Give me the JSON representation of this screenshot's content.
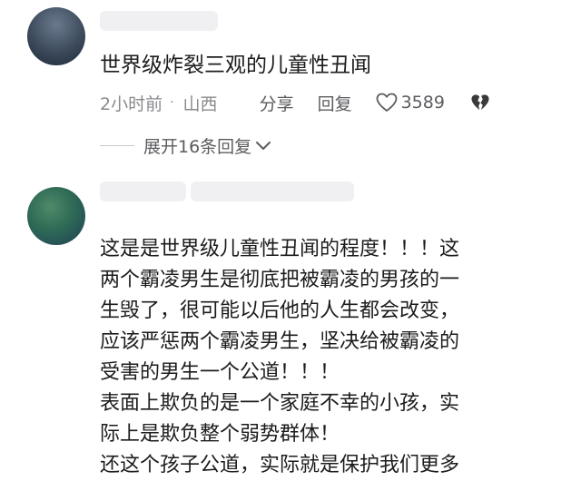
{
  "comment1": {
    "text": "世界级炸裂三观的儿童性丑闻",
    "time": "2小时前",
    "separator": "·",
    "location": "山西",
    "share_label": "分享",
    "reply_label": "回复",
    "like_count": "3589",
    "like_icon": "heart-outline-icon",
    "dislike_icon": "broken-heart-icon",
    "expand_label": "展开16条回复"
  },
  "comment2": {
    "lines": [
      "这是是世界级儿童性丑闻的程度！！！这",
      "两个霸凌男生是彻底把被霸凌的男孩的一",
      "生毁了，很可能以后他的人生都会改变，",
      "应该严惩两个霸凌男生，坚决给被霸凌的",
      "受害的男生一个公道！！！",
      "表面上欺负的是一个家庭不幸的小孩，实",
      "际上是欺负整个弱势群体！",
      "还这个孩子公道，实际就是保护我们更多"
    ]
  }
}
